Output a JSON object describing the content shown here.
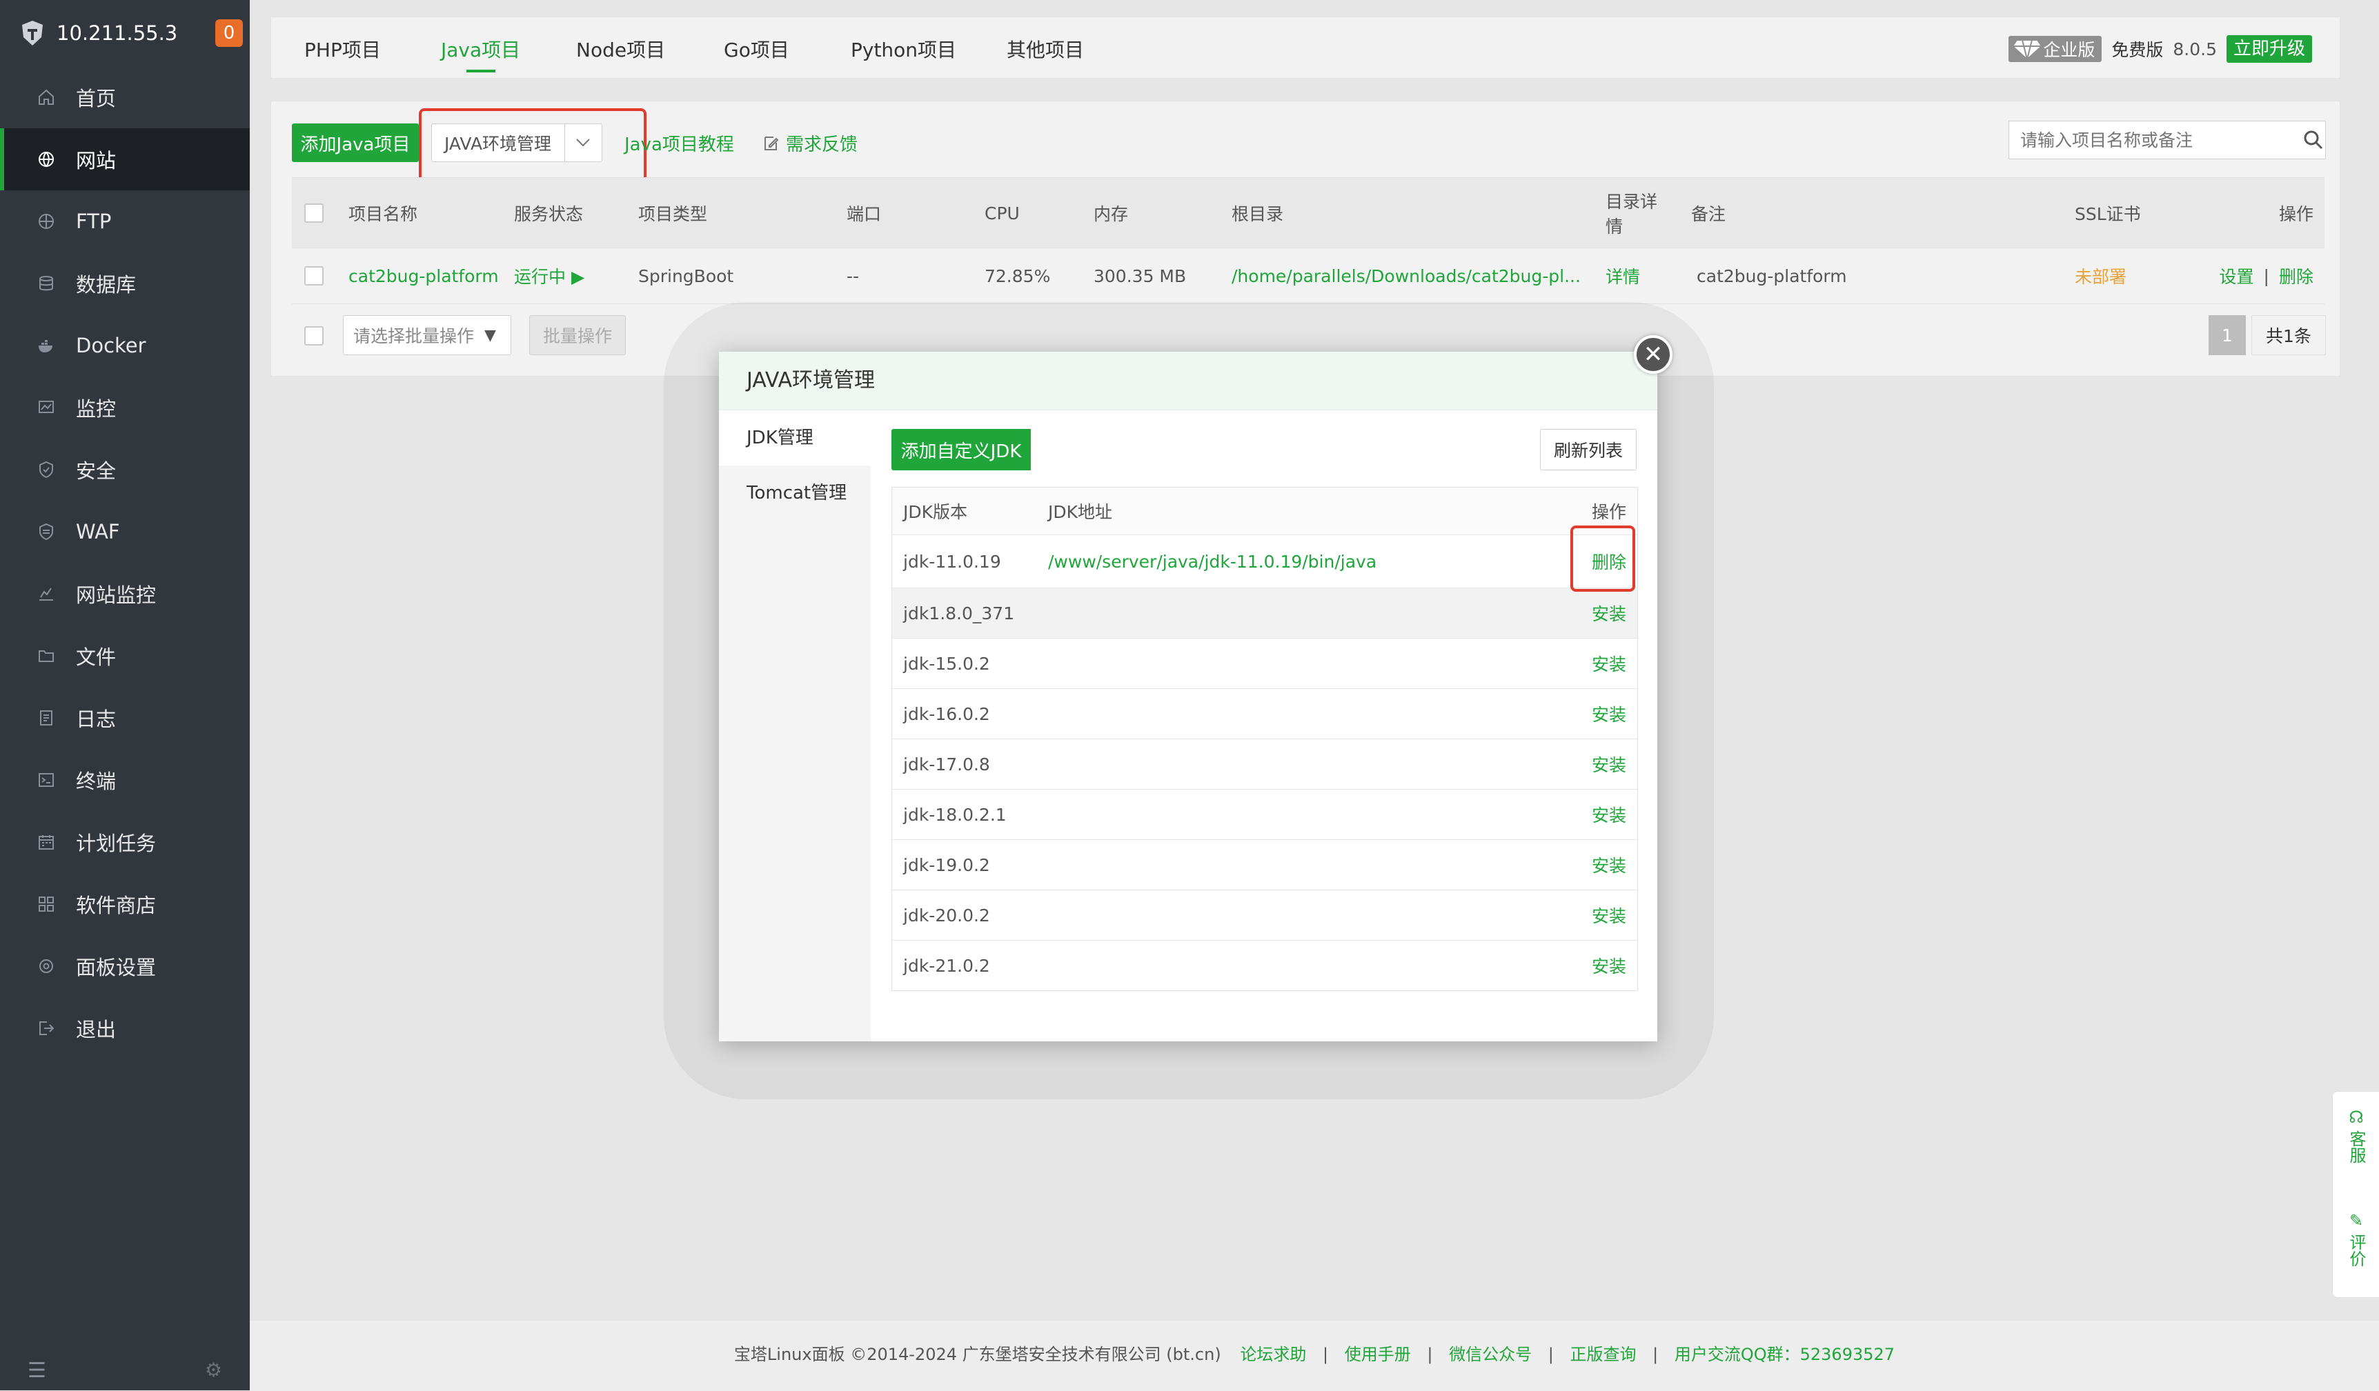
{
  "sidebar": {
    "ip": "10.211.55.3",
    "badge": "0",
    "items": [
      {
        "label": "首页",
        "icon": "home-icon"
      },
      {
        "label": "网站",
        "icon": "globe-icon"
      },
      {
        "label": "FTP",
        "icon": "ftp-icon"
      },
      {
        "label": "数据库",
        "icon": "database-icon"
      },
      {
        "label": "Docker",
        "icon": "docker-icon"
      },
      {
        "label": "监控",
        "icon": "monitor-icon"
      },
      {
        "label": "安全",
        "icon": "shield-icon"
      },
      {
        "label": "WAF",
        "icon": "waf-shield-icon"
      },
      {
        "label": "网站监控",
        "icon": "site-monitor-icon"
      },
      {
        "label": "文件",
        "icon": "folder-icon"
      },
      {
        "label": "日志",
        "icon": "log-icon"
      },
      {
        "label": "终端",
        "icon": "terminal-icon"
      },
      {
        "label": "计划任务",
        "icon": "calendar-icon"
      },
      {
        "label": "软件商店",
        "icon": "apps-icon"
      },
      {
        "label": "面板设置",
        "icon": "settings-icon"
      },
      {
        "label": "退出",
        "icon": "logout-icon"
      }
    ],
    "active_index": 1
  },
  "tabs": [
    "PHP项目",
    "Java项目",
    "Node项目",
    "Go项目",
    "Python项目",
    "其他项目"
  ],
  "active_tab": 1,
  "version": {
    "edition": "企业版",
    "free": "免费版",
    "number": "8.0.5",
    "upgrade": "立即升级"
  },
  "toolbar": {
    "add_java": "添加Java项目",
    "java_env": "JAVA环境管理",
    "tutorial": "Java项目教程",
    "feedback": "需求反馈",
    "search_placeholder": "请输入项目名称或备注"
  },
  "table": {
    "headers": {
      "name": "项目名称",
      "status": "服务状态",
      "type": "项目类型",
      "port": "端口",
      "cpu": "CPU",
      "memory": "内存",
      "root": "根目录",
      "detail_line1": "目录详",
      "detail_line2": "情",
      "remark": "备注",
      "ssl": "SSL证书",
      "ops": "操作"
    },
    "rows": [
      {
        "name": "cat2bug-platform",
        "status": "运行中 ▶",
        "type": "SpringBoot",
        "port": "--",
        "cpu": "72.85%",
        "memory": "300.35 MB",
        "root": "/home/parallels/Downloads/cat2bug-pl...",
        "detail": "详情",
        "remark": "cat2bug-platform",
        "ssl": "未部署",
        "op_settings": "设置",
        "op_sep": "|",
        "op_delete": "删除"
      }
    ],
    "batch_placeholder": "请选择批量操作",
    "batch_button": "批量操作",
    "page_current": "1",
    "page_total": "共1条"
  },
  "modal": {
    "title": "JAVA环境管理",
    "side_items": [
      "JDK管理",
      "Tomcat管理"
    ],
    "add_custom": "添加自定义JDK",
    "refresh": "刷新列表",
    "col_version": "JDK版本",
    "col_path": "JDK地址",
    "col_op": "操作",
    "jdks": [
      {
        "version": "jdk-11.0.19",
        "path": "/www/server/java/jdk-11.0.19/bin/java",
        "op": "删除"
      },
      {
        "version": "jdk1.8.0_371",
        "path": "",
        "op": "安装"
      },
      {
        "version": "jdk-15.0.2",
        "path": "",
        "op": "安装"
      },
      {
        "version": "jdk-16.0.2",
        "path": "",
        "op": "安装"
      },
      {
        "version": "jdk-17.0.8",
        "path": "",
        "op": "安装"
      },
      {
        "version": "jdk-18.0.2.1",
        "path": "",
        "op": "安装"
      },
      {
        "version": "jdk-19.0.2",
        "path": "",
        "op": "安装"
      },
      {
        "version": "jdk-20.0.2",
        "path": "",
        "op": "安装"
      },
      {
        "version": "jdk-21.0.2",
        "path": "",
        "op": "安装"
      }
    ]
  },
  "float": {
    "service": "客服",
    "review": "评价"
  },
  "footer": {
    "copyright": "宝塔Linux面板 ©2014-2024 广东堡塔安全技术有限公司 (bt.cn)",
    "forum": "论坛求助",
    "manual": "使用手册",
    "wechat": "微信公众号",
    "genuine": "正版查询",
    "qq": "用户交流QQ群：523693527",
    "sep": "|"
  },
  "colors": {
    "accent": "#20a53a",
    "sidebar": "#32373e",
    "highlight": "#e03b2d",
    "warning": "#e6a23c"
  }
}
